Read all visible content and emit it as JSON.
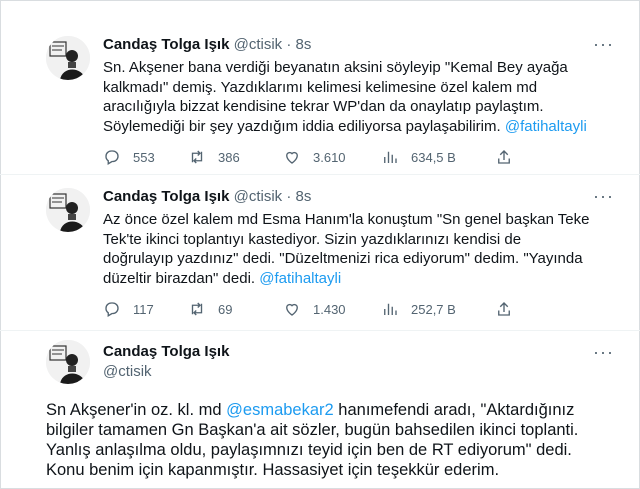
{
  "tweets": [
    {
      "name": "Candaş Tolga Işık",
      "handle": "@ctisik",
      "sep": "·",
      "time": "8s",
      "text_parts": [
        "Sn. Akşener bana verdiği beyanatın aksini söyleyip \"Kemal Bey ayağa kalkmadı\" demiş. Yazdıklarımı kelimesi kelimesine özel kalem md aracılığıyla bizzat kendisine tekrar WP'dan da onaylatıp paylaştım. Söylemediği bir şey yazdığım iddia ediliyorsa paylaşabilirim. ",
        "@fatihaltayli"
      ],
      "stats": {
        "replies": "553",
        "retweets": "386",
        "likes": "3.610",
        "views": "634,5 B"
      }
    },
    {
      "name": "Candaş Tolga Işık",
      "handle": "@ctisik",
      "sep": "·",
      "time": "8s",
      "text_parts": [
        "Az önce özel kalem md Esma Hanım'la konuştum \"Sn genel başkan Teke Tek'te ikinci toplantıyı kastediyor. Sizin yazdıklarınızı kendisi de doğrulayıp yazdınız\" dedi. \"Düzeltmenizi rica ediyorum\" dedim. \"Yayında düzeltir birazdan\" dedi. ",
        "@fatihaltayli"
      ],
      "stats": {
        "replies": "117",
        "retweets": "69",
        "likes": "1.430",
        "views": "252,7 B"
      }
    },
    {
      "name": "Candaş Tolga Işık",
      "handle": "@ctisik",
      "text_parts": [
        "Sn Akşener'in oz. kl. md ",
        "@esmabekar2",
        " hanımefendi aradı, \"Aktardığınız bilgiler tamamen Gn Başkan'a ait sözler, bugün bahsedilen ikinci toplanti. Yanlış anlaşılma oldu, paylaşımnızı teyid için ben de RT ediyorum\" dedi. Konu benim için kapanmıştır. Hassasiyet için teşekkür ederim."
      ]
    }
  ],
  "more_label": "···",
  "icons": [
    "avatar",
    "more-icon",
    "reply-icon",
    "retweet-icon",
    "like-icon",
    "views-icon",
    "share-icon"
  ],
  "colors": {
    "link": "#1d9bf0",
    "muted": "#536471",
    "text": "#0f1419"
  }
}
